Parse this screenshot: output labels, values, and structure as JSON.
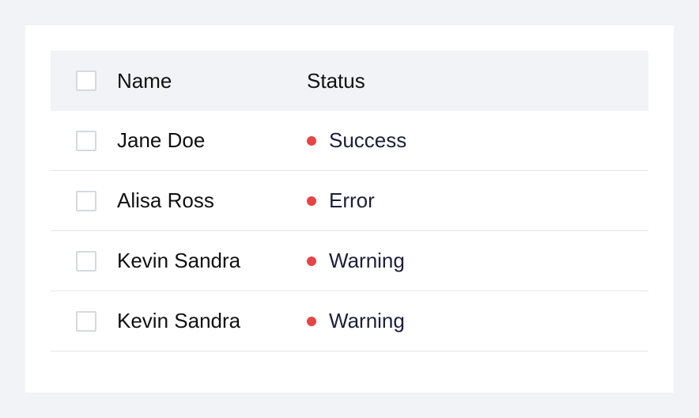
{
  "table": {
    "headers": {
      "name": "Name",
      "status": "Status"
    },
    "rows": [
      {
        "name": "Jane Doe",
        "status": "Success",
        "status_color": "#e64545"
      },
      {
        "name": "Alisa Ross",
        "status": "Error",
        "status_color": "#e64545"
      },
      {
        "name": "Kevin Sandra",
        "status": "Warning",
        "status_color": "#e64545"
      },
      {
        "name": "Kevin Sandra",
        "status": "Warning",
        "status_color": "#e64545"
      }
    ]
  },
  "icons": {
    "checkbox": "checkbox-icon",
    "status_dot": "status-dot-icon"
  },
  "colors": {
    "background": "#f2f3f7",
    "card": "#ffffff",
    "header_bg": "#f2f3f7",
    "divider": "#e3e5ea",
    "status_dot": "#e64545",
    "text_primary": "#111111",
    "text_status": "#1d1f3a"
  }
}
